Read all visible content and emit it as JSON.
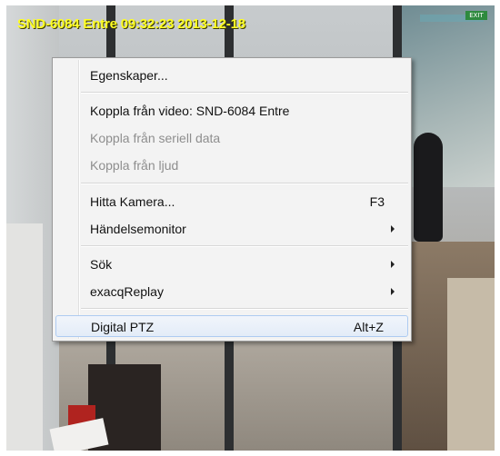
{
  "camera": {
    "overlay_title": "SND-6084 Entre 09:32:23 2013-12-18",
    "exit_sign": "EXIT"
  },
  "context_menu": {
    "items": [
      {
        "label": "Egenskaper...",
        "disabled": false
      },
      {
        "label": "Koppla från video: SND-6084 Entre",
        "disabled": false
      },
      {
        "label": "Koppla från seriell data",
        "disabled": true
      },
      {
        "label": "Koppla från ljud",
        "disabled": true
      },
      {
        "label": "Hitta Kamera...",
        "shortcut": "F3",
        "disabled": false
      },
      {
        "label": "Händelsemonitor",
        "submenu": true,
        "disabled": false
      },
      {
        "label": "Sök",
        "submenu": true,
        "disabled": false
      },
      {
        "label": "exacqReplay",
        "submenu": true,
        "disabled": false
      },
      {
        "label": "Digital PTZ",
        "shortcut": "Alt+Z",
        "highlighted": true,
        "disabled": false
      }
    ]
  },
  "colors": {
    "overlay_text": "#ffff22",
    "menu_background": "#f3f3f3",
    "highlight_border": "#aecbf1"
  }
}
